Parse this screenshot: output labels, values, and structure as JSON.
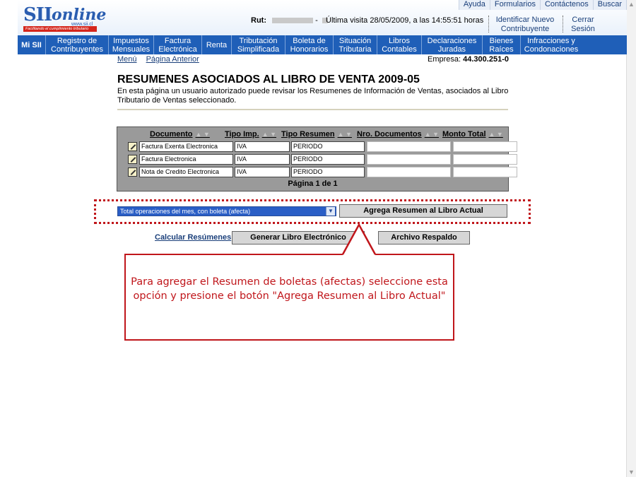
{
  "header": {
    "logo_sii": "SII",
    "logo_online": "online",
    "logo_url": "www.sii.cl",
    "logo_tagline": "Facilitando el cumplimiento tributario",
    "top_links": [
      "Ayuda",
      "Formularios",
      "Contáctenos",
      "Buscar"
    ],
    "rut_label": "Rut:",
    "rut_dash": "-",
    "last_visit": "Última visita 28/05/2009, a las 14:55:51 horas",
    "identify_new": "Identificar Nuevo Contribuyente",
    "logout": "Cerrar Sesión"
  },
  "nav": [
    "Mi SII",
    "Registro de Contribuyentes",
    "Impuestos Mensuales",
    "Factura Electrónica",
    "Renta",
    "Tributación Simplificada",
    "Boleta de Honorarios",
    "Situación Tributaria",
    "Libros Contables",
    "Declaraciones Juradas",
    "Bienes Raíces",
    "Infracciones y Condonaciones"
  ],
  "subnav": {
    "menu": "Menú",
    "prev": "Página Anterior"
  },
  "empresa": {
    "label": "Empresa:",
    "value": "44.300.251-0"
  },
  "page": {
    "title": "RESUMENES ASOCIADOS AL LIBRO DE VENTA 2009-05",
    "description": "En esta página un usuario autorizado puede revisar los Resumenes de Información de Ventas, asociados al Libro Tributario de Ventas seleccionado."
  },
  "table": {
    "headers": [
      "Documento",
      "Tipo Imp.",
      "Tipo Resumen",
      "Nro. Documentos",
      "Monto Total"
    ],
    "rows": [
      [
        "Factura Exenta Electronica",
        "IVA",
        "PERIODO",
        "",
        ""
      ],
      [
        "Factura Electronica",
        "IVA",
        "PERIODO",
        "",
        ""
      ],
      [
        "Nota de Credito Electronica",
        "IVA",
        "PERIODO",
        "",
        ""
      ]
    ],
    "pagination": "Página 1 de 1"
  },
  "form": {
    "select_value": "Total operaciones del mes, con boleta (afecta)",
    "add_button": "Agrega Resumen al Libro Actual",
    "calc_link": "Calcular Resúmenes",
    "generate_button": "Generar Libro Electrónico",
    "backup_button": "Archivo Respaldo"
  },
  "callout": {
    "text": "Para agregar el Resumen de boletas (afectas) seleccione esta opción y presione el botón \"Agrega Resumen al Libro Actual\""
  },
  "colors": {
    "nav_blue": "#1f5fb8",
    "callout_red": "#c0161b",
    "table_gray": "#9a9a9a"
  }
}
